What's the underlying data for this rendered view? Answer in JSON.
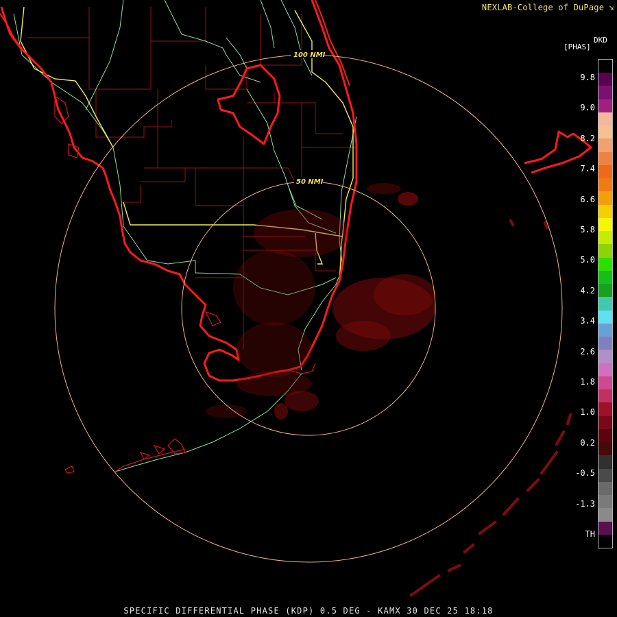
{
  "header": {
    "credit": "NEXLAB-College of DuPage",
    "logo_icon": "cod-arrow-icon"
  },
  "map": {
    "range_rings": [
      {
        "label": "100 NMI"
      },
      {
        "label": "50 NMI"
      }
    ],
    "colors": {
      "coastline": "#ff1a1a",
      "county_lines": "#a01010",
      "highways": "#90e0a0",
      "interstates": "#f5f060",
      "range_rings": "#f3b08a",
      "echo": "#7a0a0a"
    }
  },
  "legend": {
    "product_code": "DKD",
    "unit": "[PHAS]",
    "ticks": [
      "9.8",
      "9.0",
      "8.2",
      "7.4",
      "6.6",
      "5.8",
      "5.0",
      "4.2",
      "3.4",
      "2.6",
      "1.8",
      "1.0",
      "0.2",
      "-0.5",
      "-1.3",
      "TH"
    ],
    "colors": [
      "#000000",
      "#5a0050",
      "#7a1070",
      "#a02080",
      "#f3b89a",
      "#f7c090",
      "#f2a070",
      "#ef8240",
      "#ee6a18",
      "#f07c10",
      "#f3a008",
      "#f5d000",
      "#f6f600",
      "#c4ee00",
      "#8ed400",
      "#2ae000",
      "#14c018",
      "#18a020",
      "#42c8b0",
      "#60e0f0",
      "#6aa0d8",
      "#8080c0",
      "#b090c8",
      "#d070c0",
      "#d04890",
      "#c03060",
      "#a01028",
      "#7a0818",
      "#5a0410",
      "#460a0a",
      "#303030",
      "#4a4a4a",
      "#6a6a6a",
      "#7a7a7a",
      "#8a8a8a",
      "#5a1050",
      "#000000"
    ]
  },
  "footer": {
    "caption": "SPECIFIC DIFFERENTIAL PHASE (KDP) 0.5 DEG - KAMX 30 DEC 25 18:18"
  }
}
